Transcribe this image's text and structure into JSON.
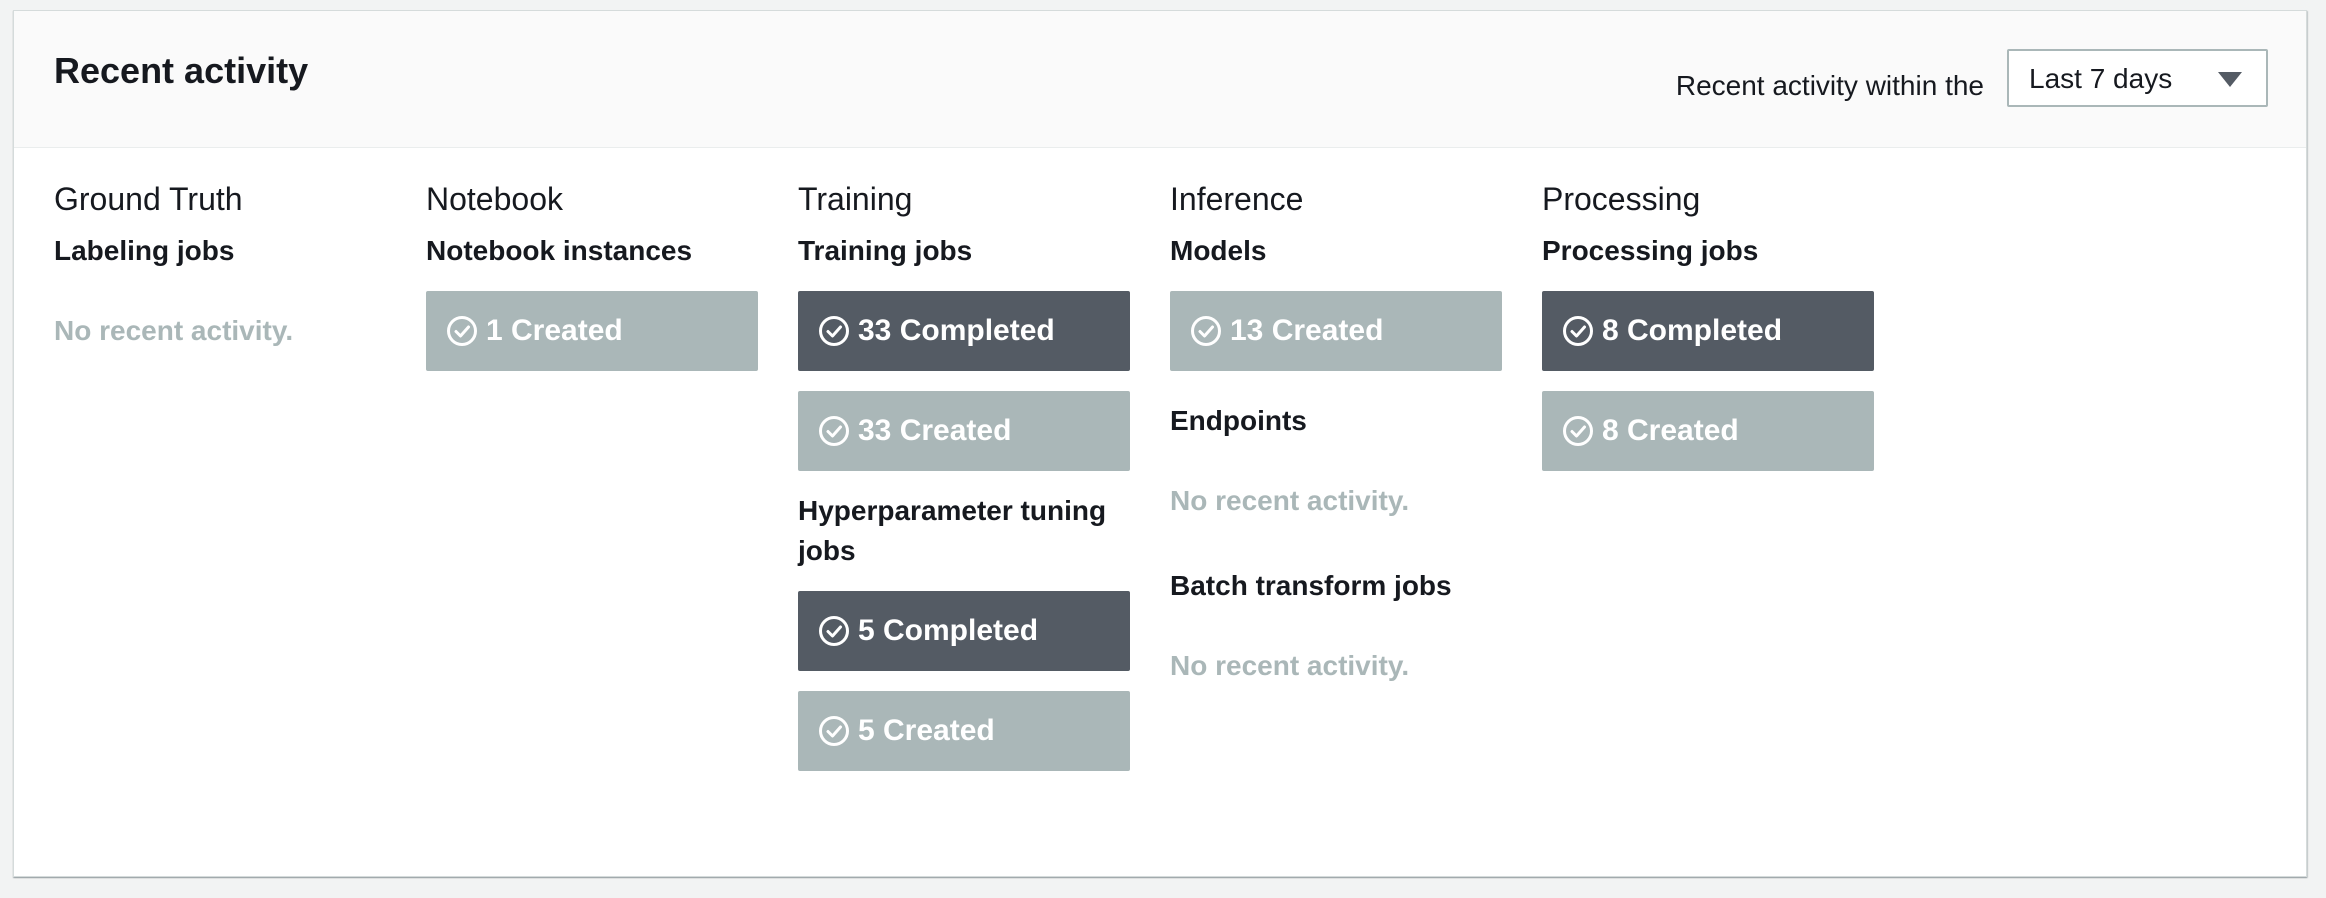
{
  "header": {
    "title": "Recent activity",
    "filter_label": "Recent activity within the",
    "filter_value": "Last 7 days"
  },
  "columns": [
    {
      "title": "Ground Truth",
      "sections": [
        {
          "title": "Labeling jobs",
          "empty": "No recent activity."
        }
      ]
    },
    {
      "title": "Notebook",
      "sections": [
        {
          "title": "Notebook instances",
          "items": [
            {
              "label": "1 Created",
              "style": "light"
            }
          ]
        }
      ]
    },
    {
      "title": "Training",
      "sections": [
        {
          "title": "Training jobs",
          "items": [
            {
              "label": "33 Completed",
              "style": "dark"
            },
            {
              "label": "33 Created",
              "style": "light"
            }
          ]
        },
        {
          "title": "Hyperparameter tuning jobs",
          "items": [
            {
              "label": "5 Completed",
              "style": "dark"
            },
            {
              "label": "5 Created",
              "style": "light"
            }
          ]
        }
      ]
    },
    {
      "title": "Inference",
      "sections": [
        {
          "title": "Models",
          "items": [
            {
              "label": "13 Created",
              "style": "light"
            }
          ]
        },
        {
          "title": "Endpoints",
          "empty": "No recent activity."
        },
        {
          "title": "Batch transform jobs",
          "empty": "No recent activity."
        }
      ]
    },
    {
      "title": "Processing",
      "sections": [
        {
          "title": "Processing jobs",
          "items": [
            {
              "label": "8 Completed",
              "style": "dark"
            },
            {
              "label": "8 Created",
              "style": "light"
            }
          ]
        }
      ]
    }
  ],
  "colors": {
    "completed": "#545b64",
    "created": "#aab7b8",
    "empty_text": "#aab7b8"
  },
  "icons": {
    "status": "check-circle-icon"
  }
}
